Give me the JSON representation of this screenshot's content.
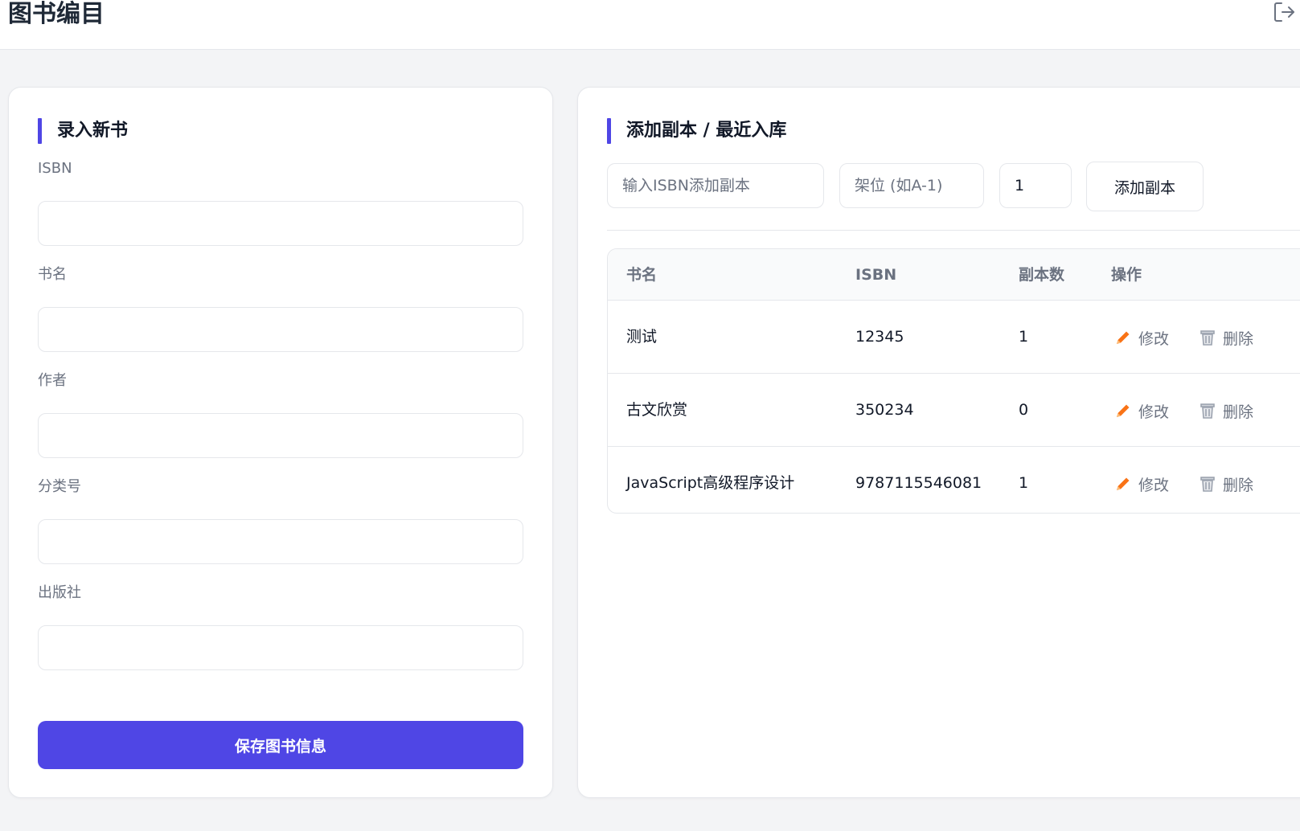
{
  "header": {
    "title": "图书编目",
    "logout_icon": "logout-icon"
  },
  "new_book": {
    "title": "录入新书",
    "fields": [
      {
        "label": "ISBN",
        "value": ""
      },
      {
        "label": "书名",
        "value": ""
      },
      {
        "label": "作者",
        "value": ""
      },
      {
        "label": "分类号",
        "value": ""
      },
      {
        "label": "出版社",
        "value": ""
      }
    ],
    "save_label": "保存图书信息"
  },
  "copies": {
    "title": "添加副本 / 最近入库",
    "isbn_placeholder": "输入ISBN添加副本",
    "shelf_placeholder": "架位 (如A-1)",
    "count_value": "1",
    "add_label": "添加副本",
    "columns": [
      "书名",
      "ISBN",
      "副本数",
      "操作"
    ],
    "rows": [
      {
        "title": "测试",
        "isbn": "12345",
        "count": "1"
      },
      {
        "title": "古文欣赏",
        "isbn": "350234",
        "count": "0"
      },
      {
        "title": "JavaScript高级程序设计",
        "isbn": "9787115546081",
        "count": "1"
      }
    ],
    "edit_label": "修改",
    "delete_label": "删除"
  },
  "colors": {
    "accent": "#4f46e5",
    "background": "#f3f4f6",
    "edit_icon": "#f97316",
    "delete_icon": "#9ca3af"
  }
}
